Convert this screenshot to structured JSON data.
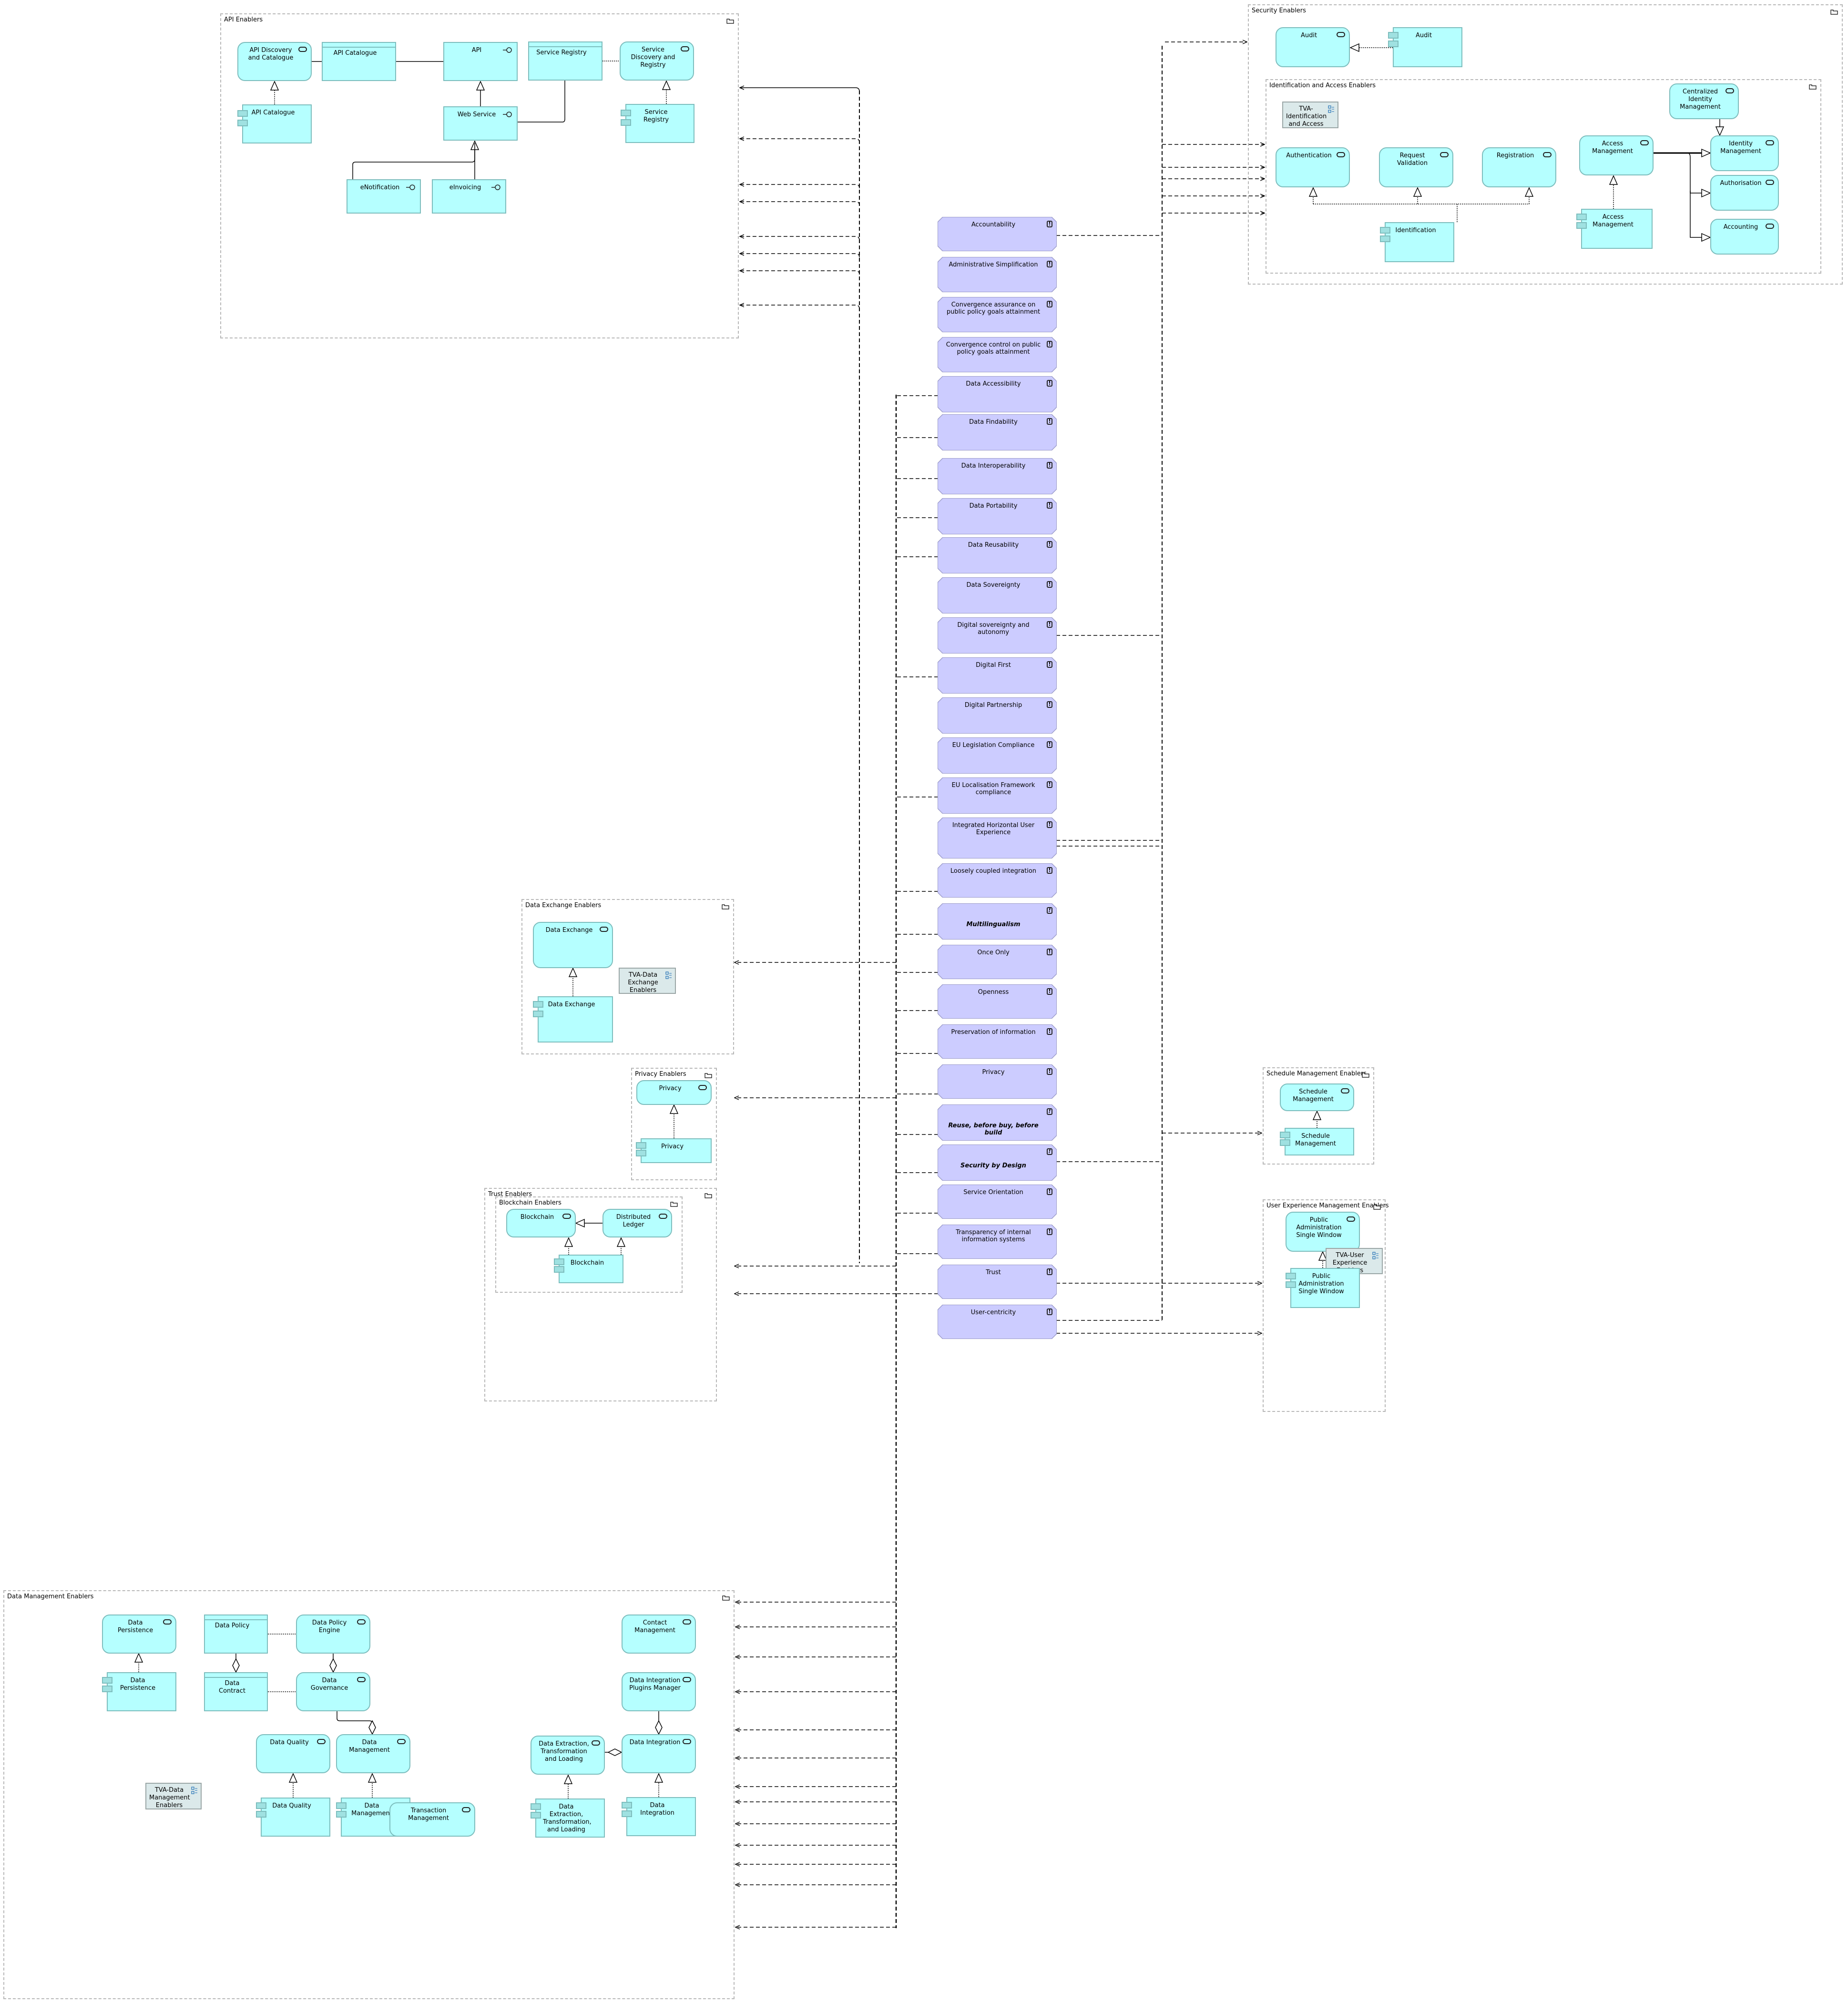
{
  "diagram": {
    "groups": {
      "api": "API Enablers",
      "security": "Security Enablers",
      "ident": "Identification and Access Enablers",
      "dataExchange": "Data Exchange Enablers",
      "privacy": "Privacy Enablers",
      "trust": "Trust Enablers",
      "blockchain": "Blockchain Enablers",
      "schedule": "Schedule Management Enablers",
      "ux": "User Experience Management Enablers",
      "dataMgmt": "Data Management Enablers"
    },
    "api": {
      "discovery_service": "API Discovery and Catalogue",
      "catalogue_object": "API Catalogue",
      "api_interface": "API",
      "registry_object": "Service Registry",
      "service_discovery": "Service Discovery and Registry",
      "catalogue_component": "API Catalogue",
      "web_service": "Web Service",
      "registry_component": "Service Registry",
      "enotification": "eNotification",
      "einvoicing": "eInvoicing"
    },
    "security": {
      "audit_service": "Audit",
      "audit_component": "Audit",
      "tva": "TVA-Identification and Access",
      "centralized_identity": "Centralized Identity Management",
      "authentication": "Authentication",
      "request_validation": "Request Validation",
      "registration": "Registration",
      "access_mgmt_service": "Access Management",
      "identity_mgmt": "Identity Management",
      "authorisation": "Authorisation",
      "accounting": "Accounting",
      "identification": "Identification",
      "access_mgmt_component": "Access Management"
    },
    "principles": [
      {
        "label": "Accountability",
        "emphasis": false
      },
      {
        "label": "Administrative Simplification",
        "emphasis": false
      },
      {
        "label": "Convergence assurance on public policy goals attainment",
        "emphasis": false
      },
      {
        "label": "Convergence control on public policy goals attainment",
        "emphasis": false
      },
      {
        "label": "Data Accessibility",
        "emphasis": false
      },
      {
        "label": "Data Findability",
        "emphasis": false
      },
      {
        "label": "Data Interoperability",
        "emphasis": false
      },
      {
        "label": "Data Portability",
        "emphasis": false
      },
      {
        "label": "Data Reusability",
        "emphasis": false
      },
      {
        "label": "Data Sovereignty",
        "emphasis": false
      },
      {
        "label": "Digital sovereignty and autonomy",
        "emphasis": false
      },
      {
        "label": "Digital First",
        "emphasis": false
      },
      {
        "label": "Digital Partnership",
        "emphasis": false
      },
      {
        "label": "EU Legislation Compliance",
        "emphasis": false
      },
      {
        "label": "EU Localisation Framework compliance",
        "emphasis": false
      },
      {
        "label": "Integrated Horizontal User Experience",
        "emphasis": false
      },
      {
        "label": "Loosely coupled integration",
        "emphasis": false
      },
      {
        "label": "Multilingualism",
        "emphasis": true
      },
      {
        "label": "Once Only",
        "emphasis": false
      },
      {
        "label": "Openness",
        "emphasis": false
      },
      {
        "label": "Preservation of information",
        "emphasis": false
      },
      {
        "label": "Privacy",
        "emphasis": false
      },
      {
        "label": "Reuse, before buy, before build",
        "emphasis": true
      },
      {
        "label": "Security by Design",
        "emphasis": true
      },
      {
        "label": "Service Orientation",
        "emphasis": false
      },
      {
        "label": "Transparency of internal information systems",
        "emphasis": false
      },
      {
        "label": "Trust",
        "emphasis": false
      },
      {
        "label": "User-centricity",
        "emphasis": false
      }
    ],
    "principle_icon": "!",
    "dataExchange": {
      "service": "Data Exchange",
      "component": "Data Exchange",
      "tva": "TVA-Data Exchange Enablers"
    },
    "privacy": {
      "service": "Privacy",
      "component": "Privacy"
    },
    "trust": {
      "blockchain_service": "Blockchain",
      "ledger_service": "Distributed Ledger",
      "blockchain_component": "Blockchain"
    },
    "schedule": {
      "service": "Schedule Management",
      "component": "Schedule Management"
    },
    "ux": {
      "service": "Public Administration Single Window",
      "tva": "TVA-User Experience Enablers",
      "component": "Public Administration Single Window"
    },
    "dataMgmt": {
      "persistence_service": "Data Persistence",
      "policy_object": "Data Policy",
      "policy_engine": "Data Policy Engine",
      "contact_mgmt": "Contact Management",
      "persistence_component": "Data Persistence",
      "contract_object": "Data Contract",
      "governance": "Data Governance",
      "plugins_manager": "Data Integration Plugins Manager",
      "tva": "TVA-Data Management Enablers",
      "quality_service": "Data Quality",
      "mgmt_service": "Data Management",
      "etl_service": "Data Extraction, Transformation and Loading",
      "integration_service": "Data Integration",
      "quality_component": "Data Quality",
      "mgmt_component": "Data Management",
      "transaction_mgmt": "Transaction Management",
      "etl_component": "Data Extraction, Transformation, and Loading",
      "integration_component": "Data Integration"
    },
    "colors": {
      "application_fill": "#b5ffff",
      "application_border": "#7dbdbd",
      "principle_fill": "#ccccff",
      "principle_border": "#9b9bc9",
      "view_ref_fill": "#dbe9ea",
      "group_border": "#b8b8b8",
      "view_icon": "#1f6fb5"
    }
  }
}
